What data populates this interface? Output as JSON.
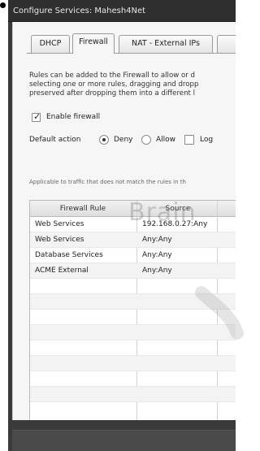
{
  "dialog": {
    "title": "Configure Services: Mahesh4Net"
  },
  "tabs": [
    {
      "label": "DHCP",
      "active": false
    },
    {
      "label": "Firewall",
      "active": true
    },
    {
      "label": "NAT - External IPs",
      "active": false
    }
  ],
  "firewall": {
    "description_lines": [
      "Rules can be added to the Firewall to allow or d",
      "selecting one or more rules, dragging and dropp",
      "preserved after dropping them into a different l"
    ],
    "enable_label": "Enable firewall",
    "enable_checked": true,
    "default_action_label": "Default action",
    "deny_label": "Deny",
    "allow_label": "Allow",
    "log_label": "Log",
    "selected_action": "Deny",
    "log_checked": false,
    "hint": "Applicable to traffic that does not match the rules in th"
  },
  "rules_table": {
    "columns": [
      "Firewall Rule",
      "Source"
    ],
    "rows": [
      {
        "rule": "Web Services",
        "source": "192.168.0.27:Any"
      },
      {
        "rule": "Web Services",
        "source": "Any:Any"
      },
      {
        "rule": "Database Services",
        "source": "Any:Any"
      },
      {
        "rule": "ACME External",
        "source": "Any:Any"
      }
    ]
  },
  "watermark": {
    "text": "Brain"
  },
  "colors": {
    "window_frame": "#3a3a3a",
    "panel_bg": "#f6f6f6",
    "table_alt_row": "#f3f3f3"
  }
}
